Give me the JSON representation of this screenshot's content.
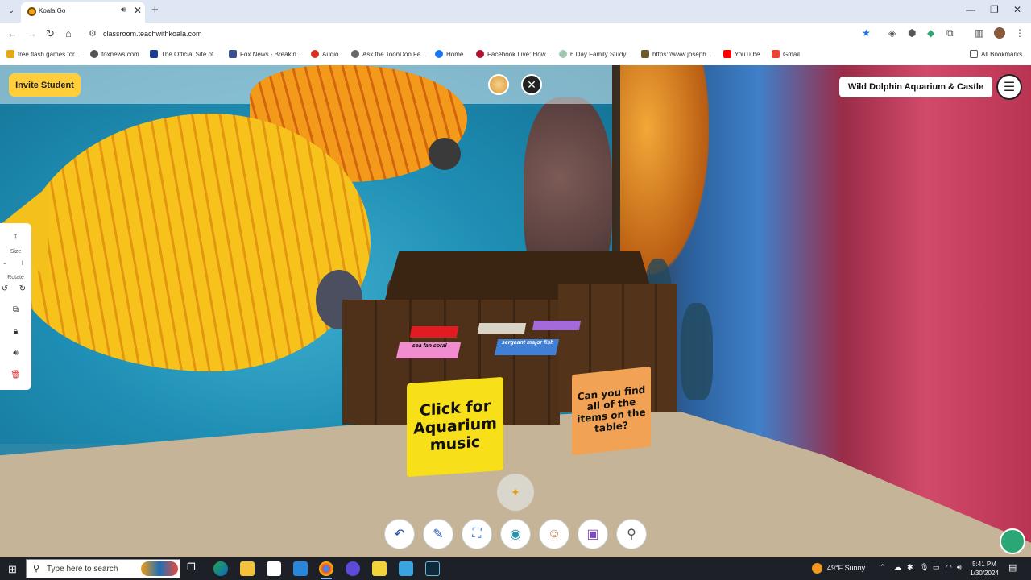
{
  "browser": {
    "tab_title": "Koala Go",
    "tab_close": "✕",
    "new_tab": "+",
    "address": "classroom.teachwithkoala.com",
    "bookmarks": [
      "free flash games for...",
      "foxnews.com",
      "The Official Site of...",
      "Fox News - Breakin...",
      "Audio",
      "Ask the ToonDoo Fe...",
      "Home",
      "Facebook Live: How...",
      "6 Day Family Study...",
      "https://www.joseph...",
      "YouTube",
      "Gmail"
    ],
    "all_bookmarks": "All Bookmarks"
  },
  "app": {
    "invite_button": "Invite Student",
    "room_title": "Wild Dolphin Aquarium & Castle",
    "close_label": "✕",
    "side_panel": {
      "size_label": "Size",
      "rotate_label": "Rotate",
      "minus": "-",
      "plus": "+"
    }
  },
  "scene": {
    "table_cards": [
      {
        "text": "",
        "color": "#e21a22"
      },
      {
        "text": "",
        "color": "#d9d4c8"
      },
      {
        "text": "",
        "color": "#a56ad9"
      },
      {
        "text": "sea fan coral",
        "color": "#f08ccf"
      },
      {
        "text": "sergeant major fish",
        "color": "#3f7fd6"
      }
    ],
    "yellow_sign": "Click for Aquarium music",
    "orange_sign": "Can you find all of the items on the table?"
  },
  "taskbar": {
    "search_placeholder": "Type here to search",
    "weather": "49°F  Sunny",
    "time": "5:41 PM",
    "date": "1/30/2024"
  },
  "colors": {
    "invite_bg": "#ffce3a",
    "taskbar_bg": "#1d2127",
    "sand": "#c6b498"
  }
}
